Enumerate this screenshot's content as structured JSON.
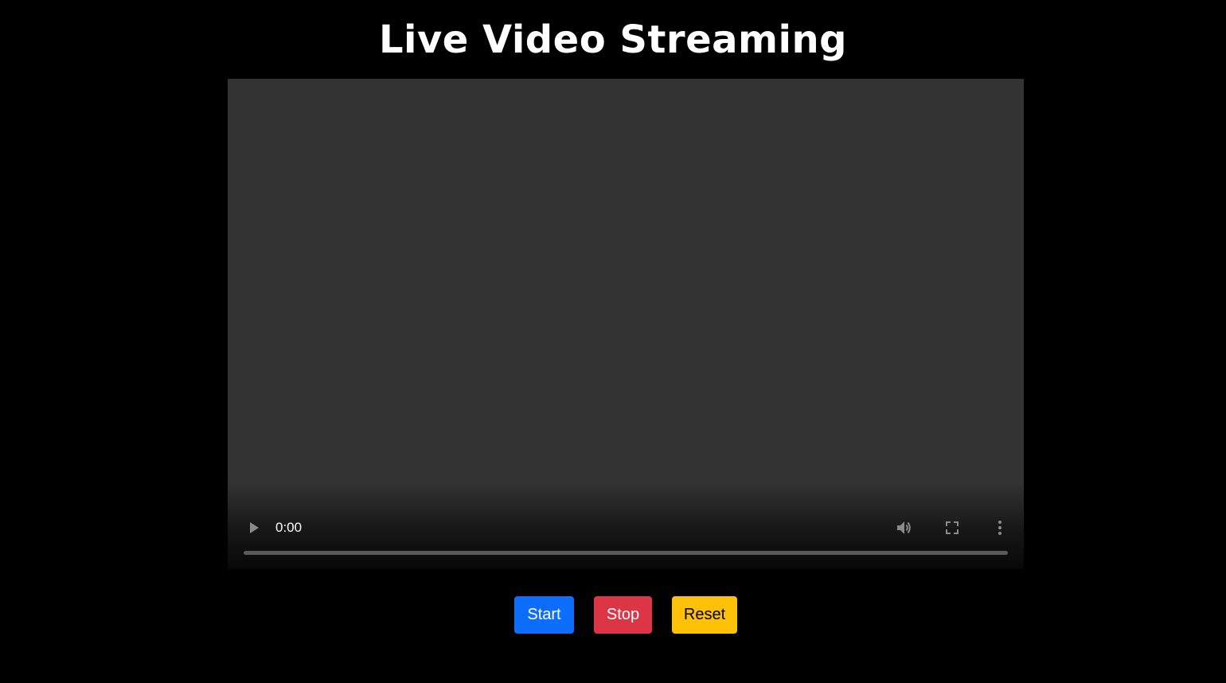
{
  "page": {
    "title": "Live Video Streaming"
  },
  "video_player": {
    "current_time": "0:00",
    "progress_fraction": 0,
    "icons": {
      "play": "play-icon",
      "volume": "volume-icon",
      "fullscreen": "fullscreen-icon",
      "more": "more-options-icon"
    }
  },
  "buttons": {
    "start_label": "Start",
    "stop_label": "Stop",
    "reset_label": "Reset"
  },
  "colors": {
    "background": "#000000",
    "video_bg": "#333333",
    "start": "#0d6efd",
    "stop": "#dc3545",
    "reset": "#ffc107"
  }
}
